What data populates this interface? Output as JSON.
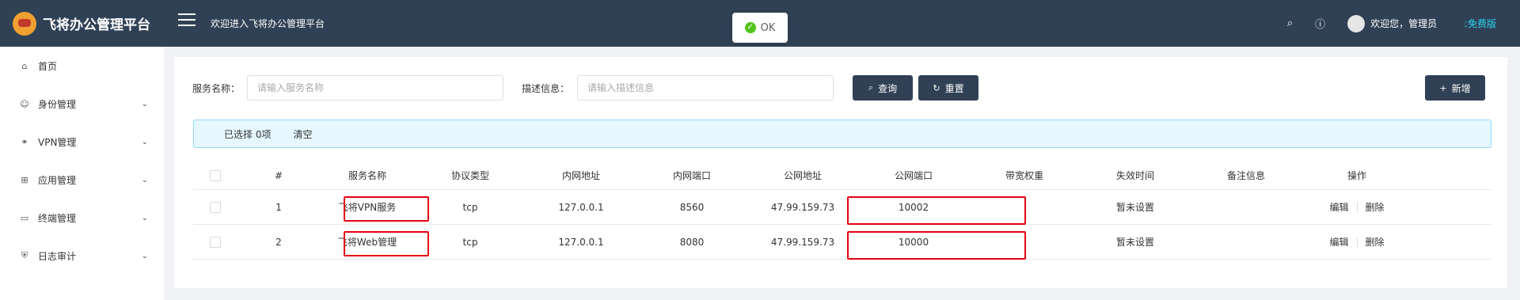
{
  "header": {
    "app_title": "飞将办公管理平台",
    "welcome": "欢迎进入飞将办公管理平台",
    "user_greeting": "欢迎您，管理员",
    "edition": "免费版",
    "search_icon": "search-icon",
    "help_icon": "question-icon"
  },
  "toast": {
    "text": "OK",
    "icon": "check-circle-icon"
  },
  "sidebar": {
    "items": [
      {
        "label": "首页",
        "icon": "home-icon",
        "has_children": false
      },
      {
        "label": "身份管理",
        "icon": "user-icon",
        "has_children": true
      },
      {
        "label": "VPN管理",
        "icon": "link-icon",
        "has_children": true
      },
      {
        "label": "应用管理",
        "icon": "grid-icon",
        "has_children": true
      },
      {
        "label": "终端管理",
        "icon": "monitor-icon",
        "has_children": true
      },
      {
        "label": "日志审计",
        "icon": "shield-icon",
        "has_children": true
      }
    ]
  },
  "search": {
    "service_name_label": "服务名称：",
    "service_name_placeholder": "请输入服务名称",
    "desc_label": "描述信息：",
    "desc_placeholder": "请输入描述信息",
    "query_label": "查询",
    "reset_label": "重置",
    "add_label": "新增"
  },
  "selection": {
    "text": "已选择 0项",
    "clear": "清空"
  },
  "table": {
    "headers": [
      "#",
      "服务名称",
      "协议类型",
      "内网地址",
      "内网端口",
      "公网地址",
      "公网端口",
      "带宽权重",
      "失效时间",
      "备注信息",
      "操作"
    ],
    "rows": [
      {
        "index": "1",
        "name": "飞将VPN服务",
        "protocol": "tcp",
        "lan_addr": "127.0.0.1",
        "lan_port": "8560",
        "wan_addr": "47.99.159.73",
        "wan_port": "10002",
        "bandwidth": "",
        "expire": "暂未设置",
        "remark": "",
        "edit": "编辑",
        "delete": "删除"
      },
      {
        "index": "2",
        "name": "飞将Web管理",
        "protocol": "tcp",
        "lan_addr": "127.0.0.1",
        "lan_port": "8080",
        "wan_addr": "47.99.159.73",
        "wan_port": "10000",
        "bandwidth": "",
        "expire": "暂未设置",
        "remark": "",
        "edit": "编辑",
        "delete": "删除"
      }
    ]
  },
  "colors": {
    "header_bg": "#304156",
    "highlight": "#e60012",
    "edition": "#2ad6ee",
    "alert_bg": "#e6f7ff"
  }
}
